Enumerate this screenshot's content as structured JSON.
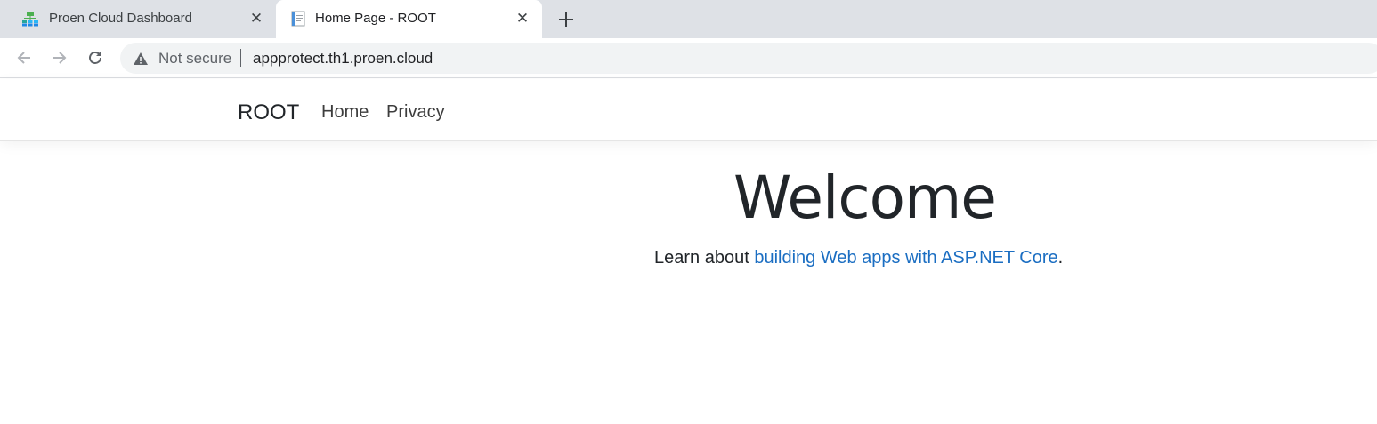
{
  "browser": {
    "tabs": [
      {
        "title": "Proen Cloud Dashboard",
        "favicon": "sitemap-icon",
        "active": false
      },
      {
        "title": "Home Page - ROOT",
        "favicon": "document-icon",
        "active": true
      }
    ],
    "address_bar": {
      "security_label": "Not secure",
      "url": "appprotect.th1.proen.cloud"
    }
  },
  "page": {
    "brand": "ROOT",
    "nav": {
      "home": "Home",
      "privacy": "Privacy"
    },
    "heading": "Welcome",
    "intro_prefix": "Learn about ",
    "intro_link": "building Web apps with ASP.NET Core",
    "intro_suffix": "."
  },
  "colors": {
    "link": "#1b6ec2",
    "tabstrip": "#dee1e6",
    "omnibox": "#f1f3f4"
  }
}
